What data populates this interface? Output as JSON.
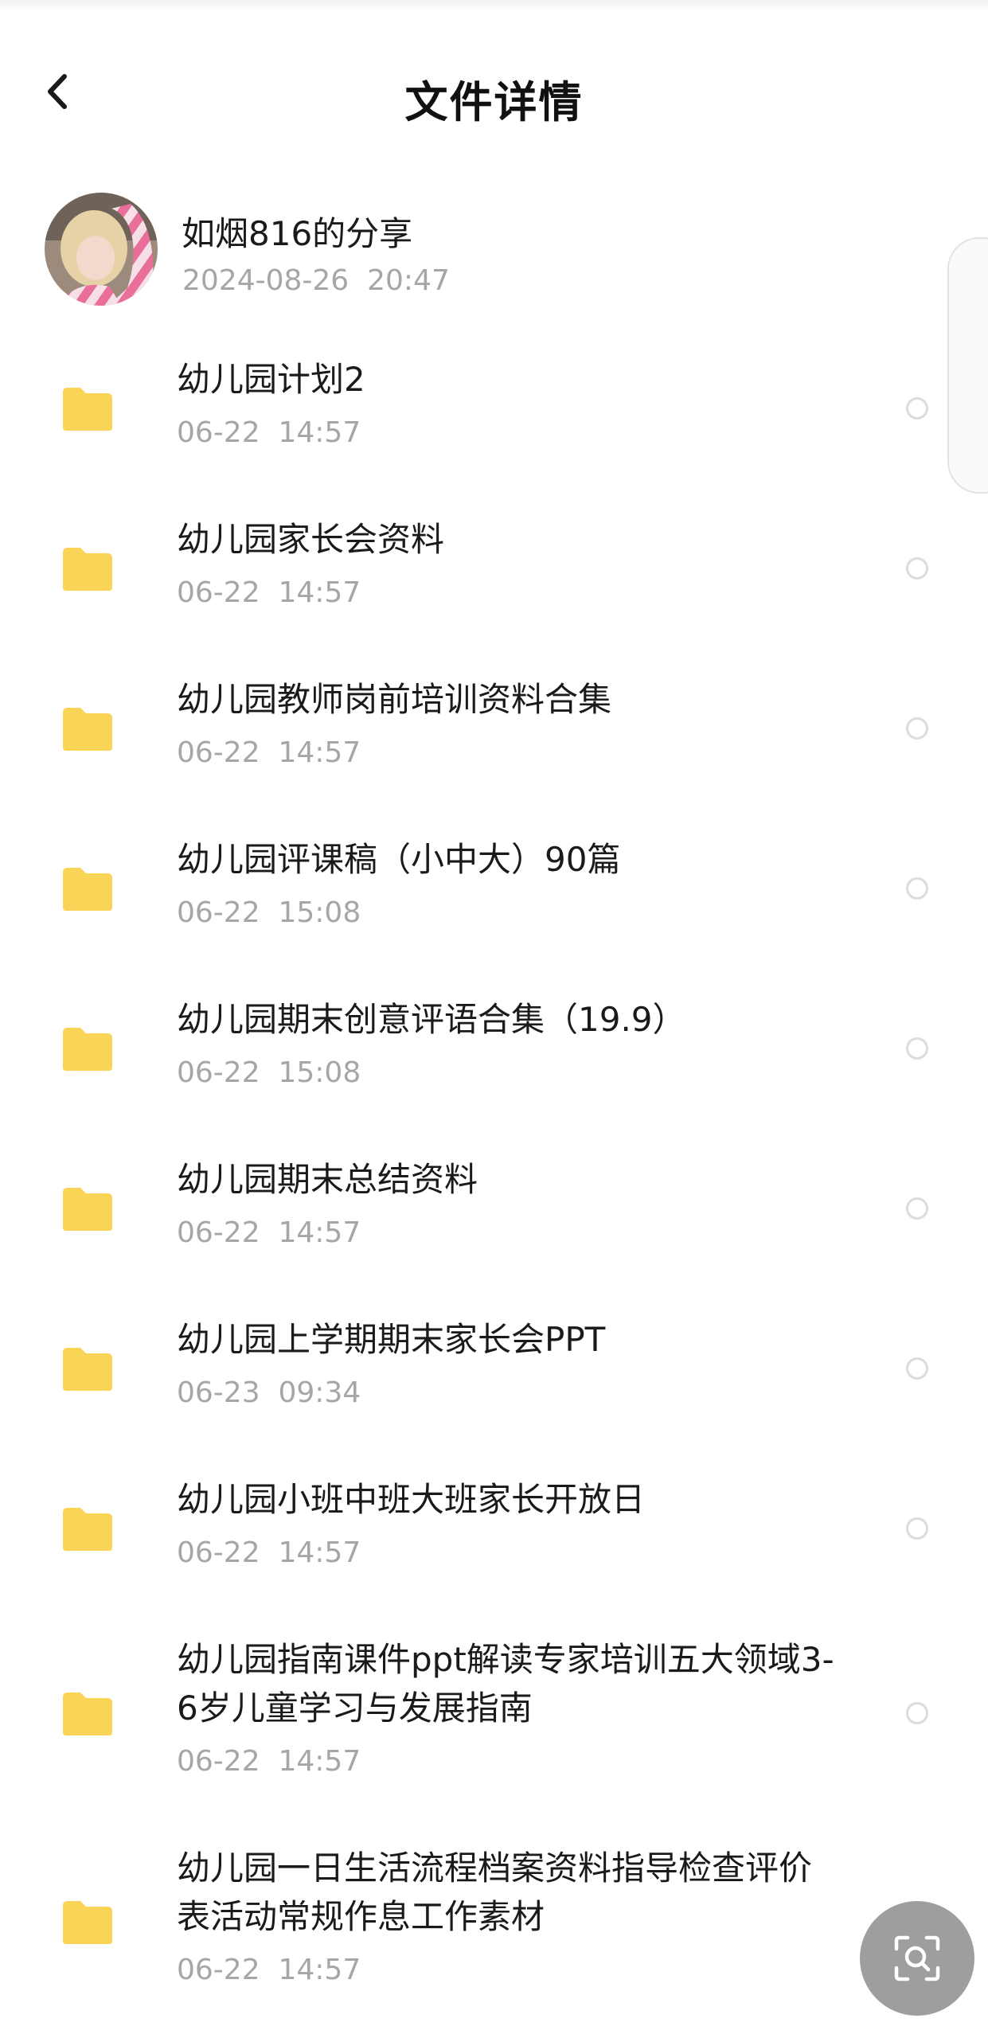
{
  "header": {
    "title": "文件详情",
    "back_icon": "chevron-left-icon"
  },
  "sharer": {
    "name": "如烟816的分享",
    "time": "2024-08-26  20:47"
  },
  "files": [
    {
      "name": "幼儿园计划2",
      "date": "06-22  14:57",
      "icon": "folder-icon"
    },
    {
      "name": "幼儿园家长会资料",
      "date": "06-22  14:57",
      "icon": "folder-icon"
    },
    {
      "name": "幼儿园教师岗前培训资料合集",
      "date": "06-22  14:57",
      "icon": "folder-icon"
    },
    {
      "name": "幼儿园评课稿（小中大）90篇",
      "date": "06-22  15:08",
      "icon": "folder-icon"
    },
    {
      "name": "幼儿园期末创意评语合集（19.9）",
      "date": "06-22  15:08",
      "icon": "folder-icon"
    },
    {
      "name": "幼儿园期末总结资料",
      "date": "06-22  14:57",
      "icon": "folder-icon"
    },
    {
      "name": "幼儿园上学期期末家长会PPT",
      "date": "06-23  09:34",
      "icon": "folder-icon"
    },
    {
      "name": "幼儿园小班中班大班家长开放日",
      "date": "06-22  14:57",
      "icon": "folder-icon"
    },
    {
      "name": "幼儿园指南课件ppt解读专家培训五大领域3-6岁儿童学习与发展指南",
      "date": "06-22  14:57",
      "icon": "folder-icon"
    },
    {
      "name": "幼儿园一日生活流程档案资料指导检查评价表活动常规作息工作素材",
      "date": "06-22  14:57",
      "icon": "folder-icon"
    }
  ],
  "scan_button": {
    "icon": "scan-search-icon"
  },
  "colors": {
    "folder": "#FAD456",
    "secondary_text": "#A6A6A6",
    "scan_button": "#9E9E9E"
  }
}
